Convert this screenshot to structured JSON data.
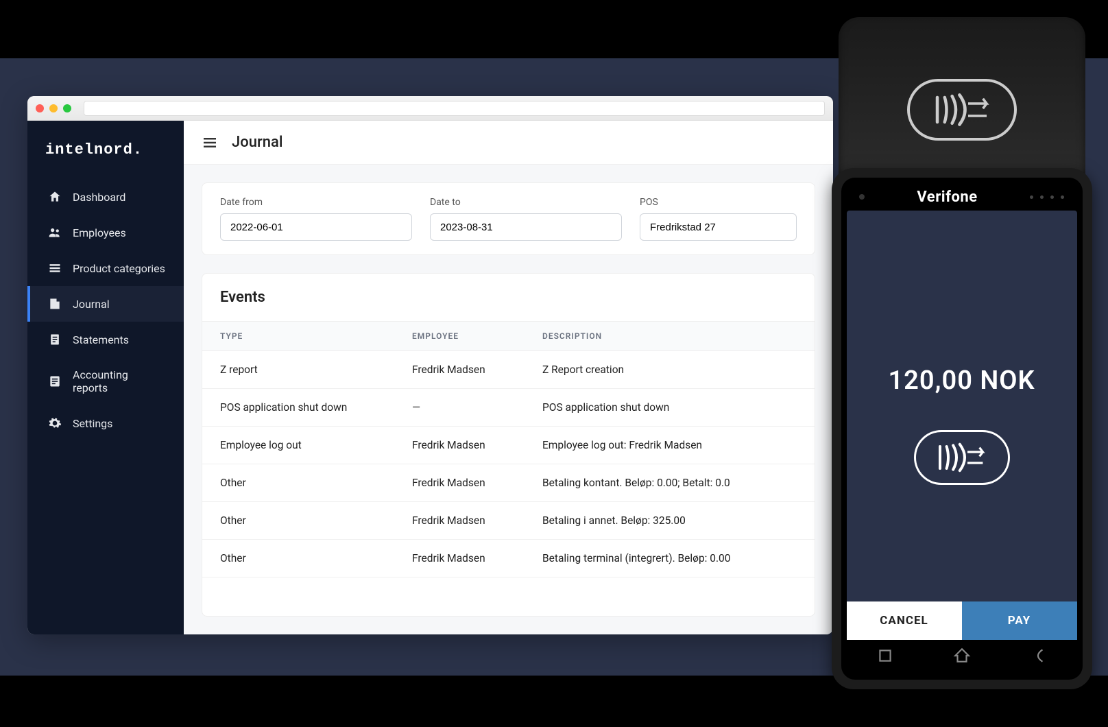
{
  "brand": "intelnord.",
  "sidebar": {
    "items": [
      {
        "label": "Dashboard",
        "icon": "home"
      },
      {
        "label": "Employees",
        "icon": "people"
      },
      {
        "label": "Product categories",
        "icon": "categories"
      },
      {
        "label": "Journal",
        "icon": "journal"
      },
      {
        "label": "Statements",
        "icon": "statements"
      },
      {
        "label": "Accounting reports",
        "icon": "reports"
      },
      {
        "label": "Settings",
        "icon": "gear"
      }
    ],
    "active_index": 3
  },
  "page": {
    "title": "Journal"
  },
  "filters": {
    "date_from_label": "Date from",
    "date_from_value": "2022-06-01",
    "date_to_label": "Date to",
    "date_to_value": "2023-08-31",
    "pos_label": "POS",
    "pos_value": "Fredrikstad 27"
  },
  "events": {
    "title": "Events",
    "headers": {
      "type": "TYPE",
      "employee": "EMPLOYEE",
      "description": "DESCRIPTION"
    },
    "rows": [
      {
        "type": "Z report",
        "employee": "Fredrik Madsen",
        "description": "Z Report creation"
      },
      {
        "type": "POS application shut down",
        "employee": "—",
        "description": "POS application shut down"
      },
      {
        "type": "Employee log out",
        "employee": "Fredrik Madsen",
        "description": "Employee log out: Fredrik Madsen"
      },
      {
        "type": "Other",
        "employee": "Fredrik Madsen",
        "description": "Betaling kontant. Beløp: 0.00; Betalt: 0.0"
      },
      {
        "type": "Other",
        "employee": "Fredrik Madsen",
        "description": "Betaling i annet. Beløp: 325.00"
      },
      {
        "type": "Other",
        "employee": "Fredrik Madsen",
        "description": "Betaling terminal (integrert). Beløp: 0.00"
      }
    ]
  },
  "terminal": {
    "brand": "Verifone",
    "amount": "120,00 NOK",
    "cancel": "CANCEL",
    "pay": "PAY"
  }
}
